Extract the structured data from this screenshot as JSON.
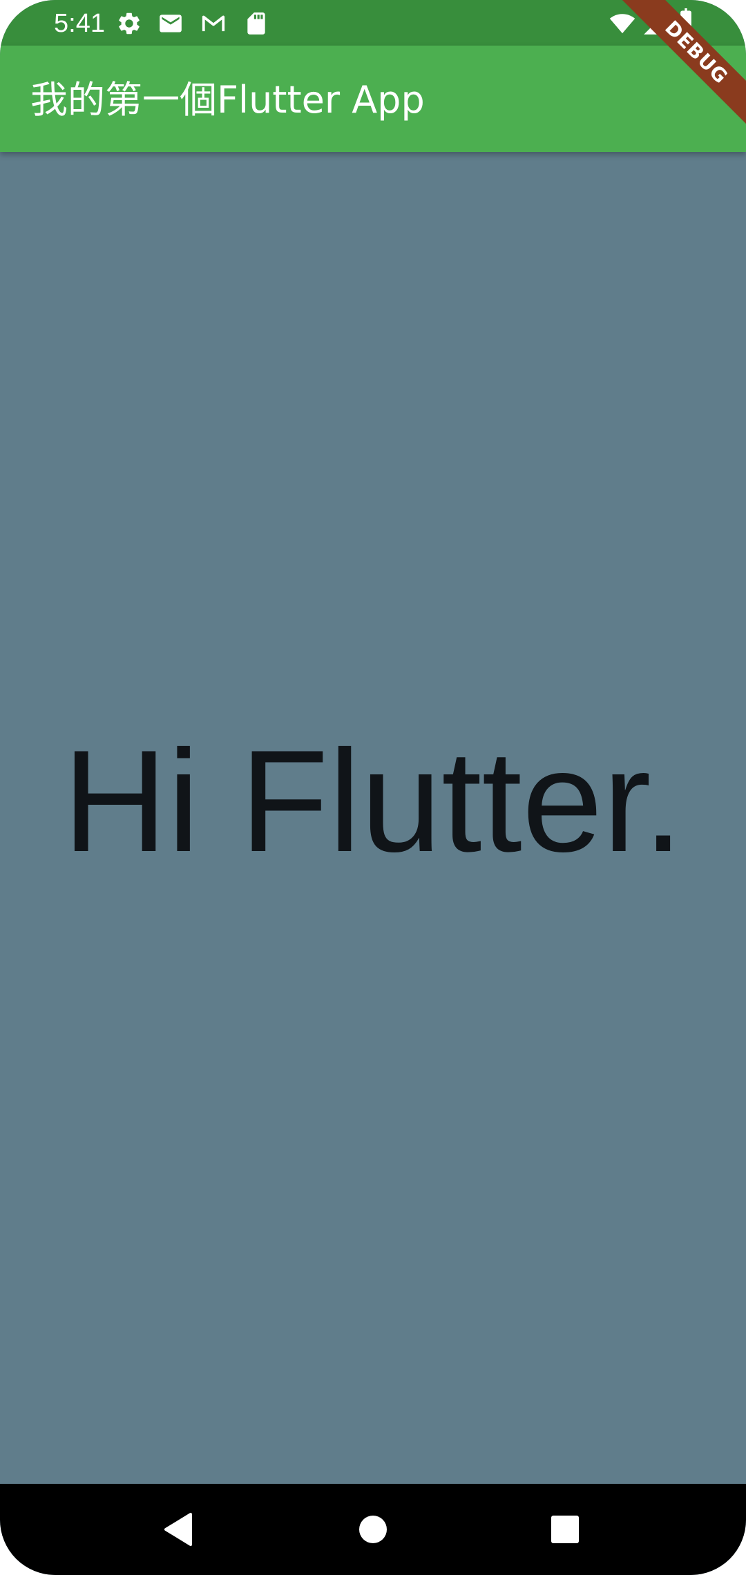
{
  "status_bar": {
    "time": "5:41",
    "left_icons": [
      "settings-icon",
      "mail-icon",
      "gmail-icon",
      "sd-card-icon"
    ],
    "right_icons": [
      "wifi-icon",
      "cell-signal-icon",
      "battery-icon"
    ]
  },
  "app_bar": {
    "title": "我的第一個Flutter App"
  },
  "body": {
    "text": "Hi Flutter."
  },
  "debug_banner": {
    "label": "DEBUG"
  },
  "nav_bar": {
    "buttons": [
      "back-icon",
      "home-icon",
      "recents-icon"
    ]
  },
  "colors": {
    "status_bar": "#388e3c",
    "app_bar": "#4caf50",
    "background": "#607d8b",
    "text": "#101418",
    "debug_banner": "#8a3b1e",
    "nav_bar": "#000000"
  }
}
